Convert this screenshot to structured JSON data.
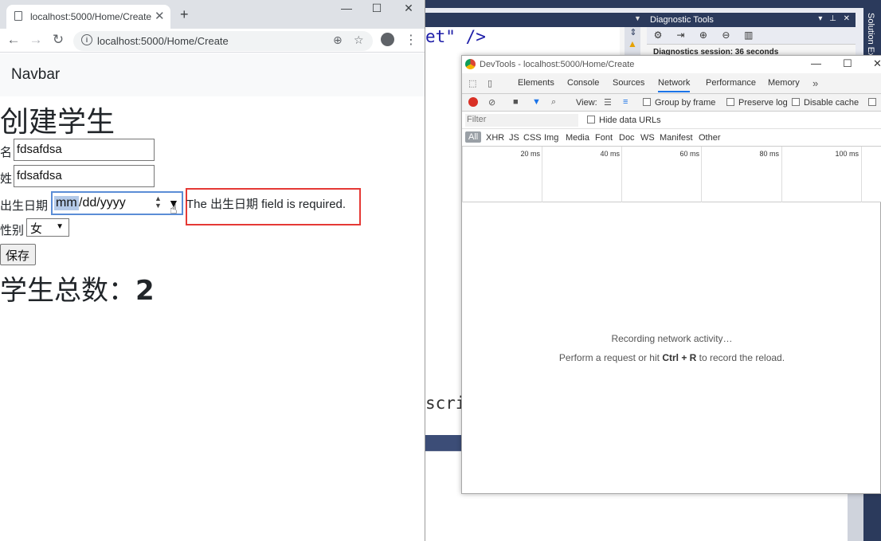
{
  "browser": {
    "tab_title": "localhost:5000/Home/Create",
    "url": "localhost:5000/Home/Create"
  },
  "page": {
    "navbar_brand": "Navbar",
    "heading": "创建学生",
    "fields": {
      "first_name_label": "名",
      "first_name_value": "fdsafdsa",
      "last_name_label": "姓",
      "last_name_value": "fdsafdsa",
      "dob_label": "出生日期",
      "dob_mm": "mm",
      "dob_rest": "/dd/yyyy",
      "dob_error": "The 出生日期 field is required.",
      "gender_label": "性别",
      "gender_value": "女"
    },
    "save_button": "保存",
    "total_label": "学生总数：",
    "total_value": "2"
  },
  "vs": {
    "code_line1": "et\" />",
    "code_line2": "scrip",
    "diag_title": "Diagnostic Tools",
    "diag_session": "Diagnostics session: 36 seconds",
    "solution_tab": "Solution Ex"
  },
  "devtools": {
    "title": "DevTools - localhost:5000/Home/Create",
    "tabs": [
      "Elements",
      "Console",
      "Sources",
      "Network",
      "Performance",
      "Memory"
    ],
    "active_tab": "Network",
    "view_label": "View:",
    "group_by_frame": "Group by frame",
    "preserve_log": "Preserve log",
    "disable_cache": "Disable cache",
    "filter_placeholder": "Filter",
    "hide_data_urls": "Hide data URLs",
    "types": [
      "All",
      "XHR",
      "JS",
      "CSS",
      "Img",
      "Media",
      "Font",
      "Doc",
      "WS",
      "Manifest",
      "Other"
    ],
    "ticks": [
      "20 ms",
      "40 ms",
      "60 ms",
      "80 ms",
      "100 ms"
    ],
    "recording": "Recording network activity…",
    "hint_pre": "Perform a request or hit ",
    "hint_keys": "Ctrl + R",
    "hint_post": " to record the reload."
  }
}
